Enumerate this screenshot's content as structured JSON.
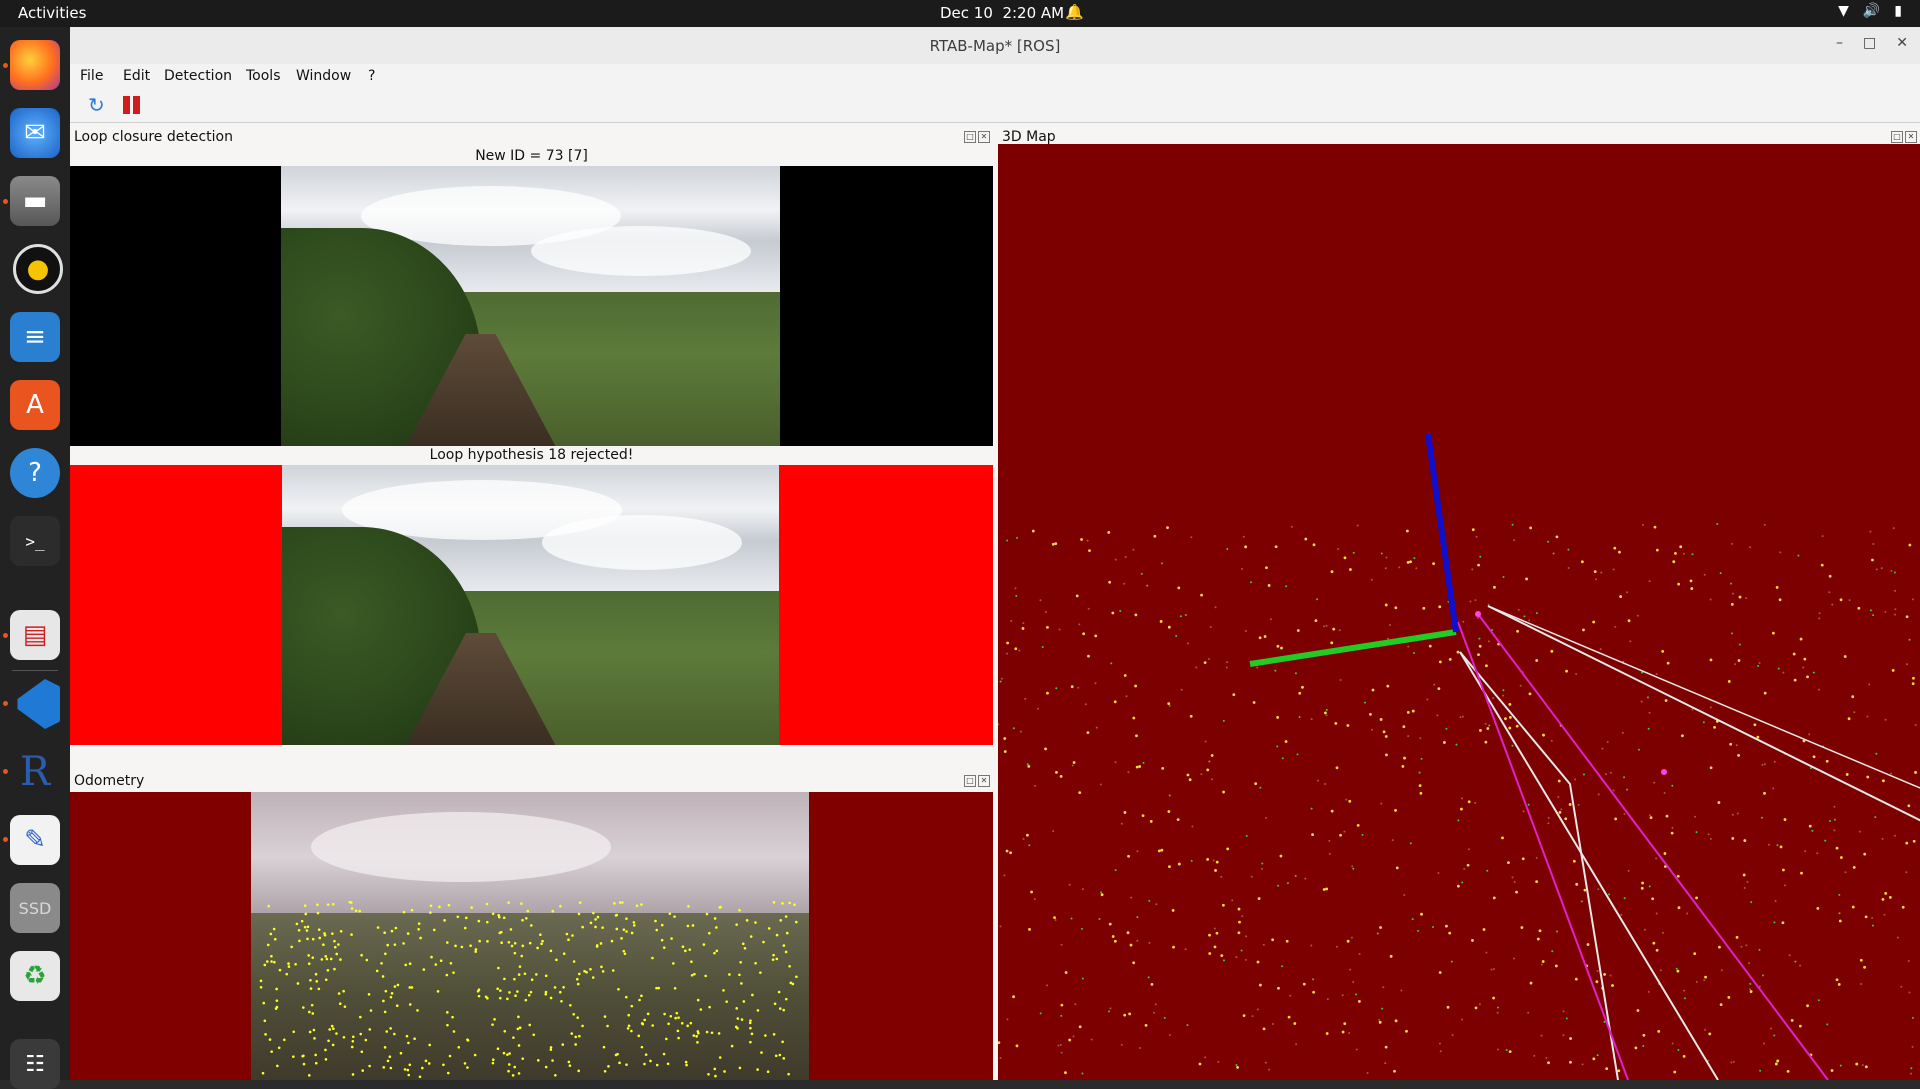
{
  "topbar": {
    "activities": "Activities",
    "date": "Dec 10",
    "time": "2:20 AM"
  },
  "window": {
    "title": "RTAB-Map* [ROS]"
  },
  "menu": [
    "File",
    "Edit",
    "Detection",
    "Tools",
    "Window",
    "?"
  ],
  "panels": {
    "loop": {
      "title": "Loop closure detection",
      "new_id_label": "New ID = 73 [7]",
      "hypothesis_label": "Loop hypothesis 18 rejected!"
    },
    "odometry": {
      "title": "Odometry"
    },
    "map3d": {
      "title": "3D Map"
    }
  },
  "dock": [
    {
      "name": "firefox-icon"
    },
    {
      "name": "thunderbird-icon"
    },
    {
      "name": "files-icon"
    },
    {
      "name": "rhythmbox-icon"
    },
    {
      "name": "writer-icon"
    },
    {
      "name": "app-center-icon"
    },
    {
      "name": "help-icon"
    },
    {
      "name": "terminal-icon"
    },
    {
      "name": "document-viewer-icon"
    },
    {
      "name": "vscode-icon"
    },
    {
      "name": "r-icon"
    },
    {
      "name": "text-editor-icon"
    },
    {
      "name": "ssd-drive-icon",
      "label": "SSD"
    },
    {
      "name": "trash-icon"
    },
    {
      "name": "show-apps-icon"
    }
  ],
  "colors": {
    "map_background": "#7d0000",
    "axis_x": "#22cc22",
    "axis_z": "#1010cc",
    "loop_reject_bg": "#ff0000",
    "odom_bg": "#800000"
  }
}
